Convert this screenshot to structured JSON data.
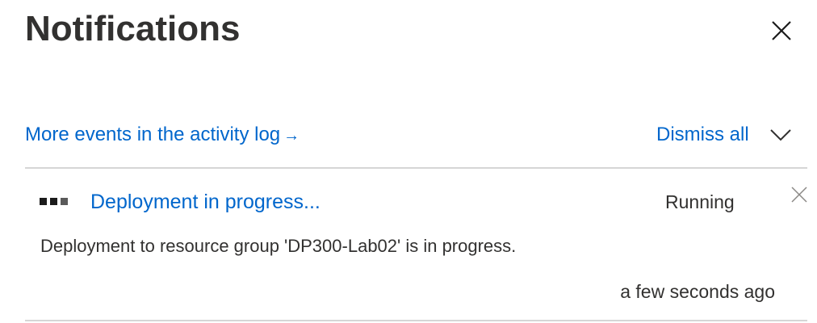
{
  "panel": {
    "title": "Notifications"
  },
  "actions": {
    "activity_log_link": "More events in the activity log",
    "arrow": "→",
    "dismiss_all": "Dismiss all"
  },
  "notifications": [
    {
      "title": "Deployment in progress...",
      "status": "Running",
      "body": "Deployment to resource group 'DP300-Lab02' is in progress.",
      "time": "a few seconds ago"
    }
  ],
  "icons": {
    "close_panel": "close-icon",
    "collapse": "chevron-down-icon",
    "notification_dismiss": "close-icon",
    "progress": "progress-dots-icon"
  },
  "colors": {
    "link": "#0066cc",
    "text": "#323130",
    "divider": "#d6d6d6"
  }
}
